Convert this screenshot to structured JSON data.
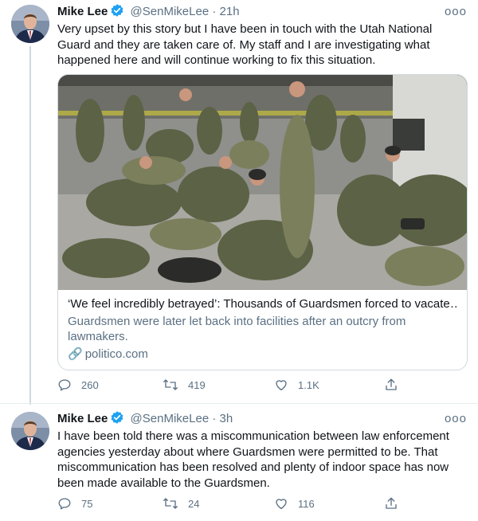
{
  "tweets": [
    {
      "author": {
        "name": "Mike Lee",
        "handle": "@SenMikeLee",
        "avatar_icon": "avatar-portrait"
      },
      "time": "21h",
      "separator": "·",
      "more_icon": "more-horizontal-icon",
      "more_label": "ooo",
      "text": "Very upset by this story but I have been in touch with the Utah National Guard and they are taken care of. My staff and I are investigating what happened here and will continue working to fix this situation.",
      "card": {
        "title": "‘We feel incredibly betrayed’: Thousands of Guardsmen forced to vacate…",
        "description": "Guardsmen were later let back into facilities after an outcry from lawmakers.",
        "domain": "politico.com",
        "link_glyph": "🔗"
      },
      "actions": {
        "replies": "260",
        "retweets": "419",
        "likes": "1.1K"
      }
    },
    {
      "author": {
        "name": "Mike Lee",
        "handle": "@SenMikeLee",
        "avatar_icon": "avatar-portrait"
      },
      "time": "3h",
      "separator": "·",
      "more_icon": "more-horizontal-icon",
      "more_label": "ooo",
      "text": "I have been told there was a miscommunication between law enforcement agencies yesterday about where Guardsmen were permitted to be. That miscommunication has been resolved and plenty of indoor space has now been made available to the Guardsmen.",
      "actions": {
        "replies": "75",
        "retweets": "24",
        "likes": "116"
      }
    }
  ],
  "colors": {
    "verified": "#1da1f2",
    "secondary_text": "#5b7083",
    "border": "#cfd9de"
  }
}
